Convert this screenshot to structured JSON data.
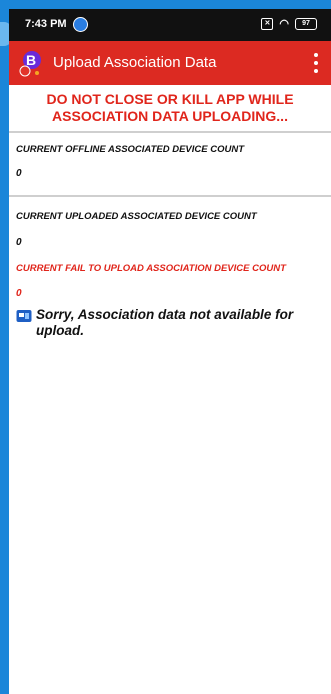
{
  "status_bar": {
    "time": "7:43 PM",
    "battery": "97"
  },
  "toolbar": {
    "title": "Upload Association Data"
  },
  "warning": {
    "line1": "DO NOT CLOSE OR KILL APP WHILE",
    "line2": "ASSOCIATION DATA UPLOADING..."
  },
  "stats": {
    "offline_label": "CURRENT OFFLINE ASSOCIATED DEVICE COUNT",
    "offline_value": "0",
    "uploaded_label": "CURRENT UPLOADED ASSOCIATED DEVICE COUNT",
    "uploaded_value": "0",
    "failed_label": "CURRENT FAIL TO UPLOAD ASSOCIATION DEVICE COUNT",
    "failed_value": "0"
  },
  "message": {
    "text": "Sorry, Association data not available for upload."
  },
  "colors": {
    "toolbar": "#dc2a22",
    "warning": "#e0251b",
    "frame": "#1b86d9"
  }
}
